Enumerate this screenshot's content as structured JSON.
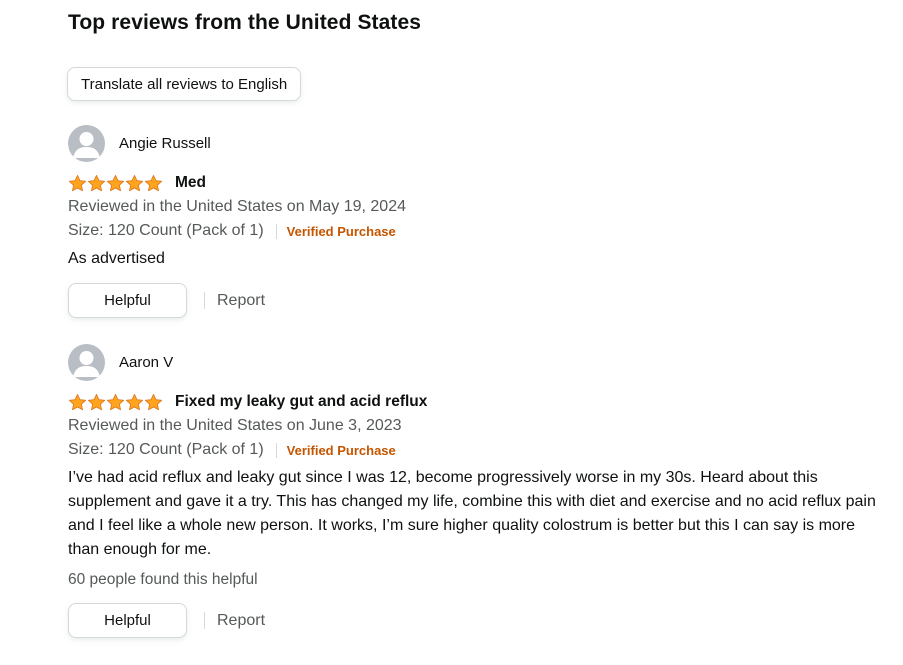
{
  "section": {
    "title": "Top reviews from the United States",
    "translate_label": "Translate all reviews to English"
  },
  "colors": {
    "star": "#ffa41c",
    "star_stroke": "#de7921",
    "verified": "#c45500",
    "secondary_text": "#565959"
  },
  "reviews": [
    {
      "author": "Angie Russell",
      "rating": 5,
      "rating_max": 5,
      "title": "Med",
      "date": "Reviewed in the United States on May 19, 2024",
      "size": "Size: 120 Count (Pack of 1)",
      "verified": "Verified Purchase",
      "body": "As advertised",
      "helpful_count": "",
      "helpful_label": "Helpful",
      "report_label": "Report"
    },
    {
      "author": "Aaron V",
      "rating": 5,
      "rating_max": 5,
      "title": "Fixed my leaky gut and acid reflux",
      "date": "Reviewed in the United States on June 3, 2023",
      "size": "Size: 120 Count (Pack of 1)",
      "verified": "Verified Purchase",
      "body": "I’ve had acid reflux and leaky gut since I was 12, become progressively worse in my 30s. Heard about this supplement and gave it a try. This has changed my life, combine this with diet and exercise and no acid reflux pain and I feel like a whole new person. It works, I’m sure higher quality colostrum is better but this I can say is more than enough for me.",
      "helpful_count": "60 people found this helpful",
      "helpful_label": "Helpful",
      "report_label": "Report"
    }
  ]
}
